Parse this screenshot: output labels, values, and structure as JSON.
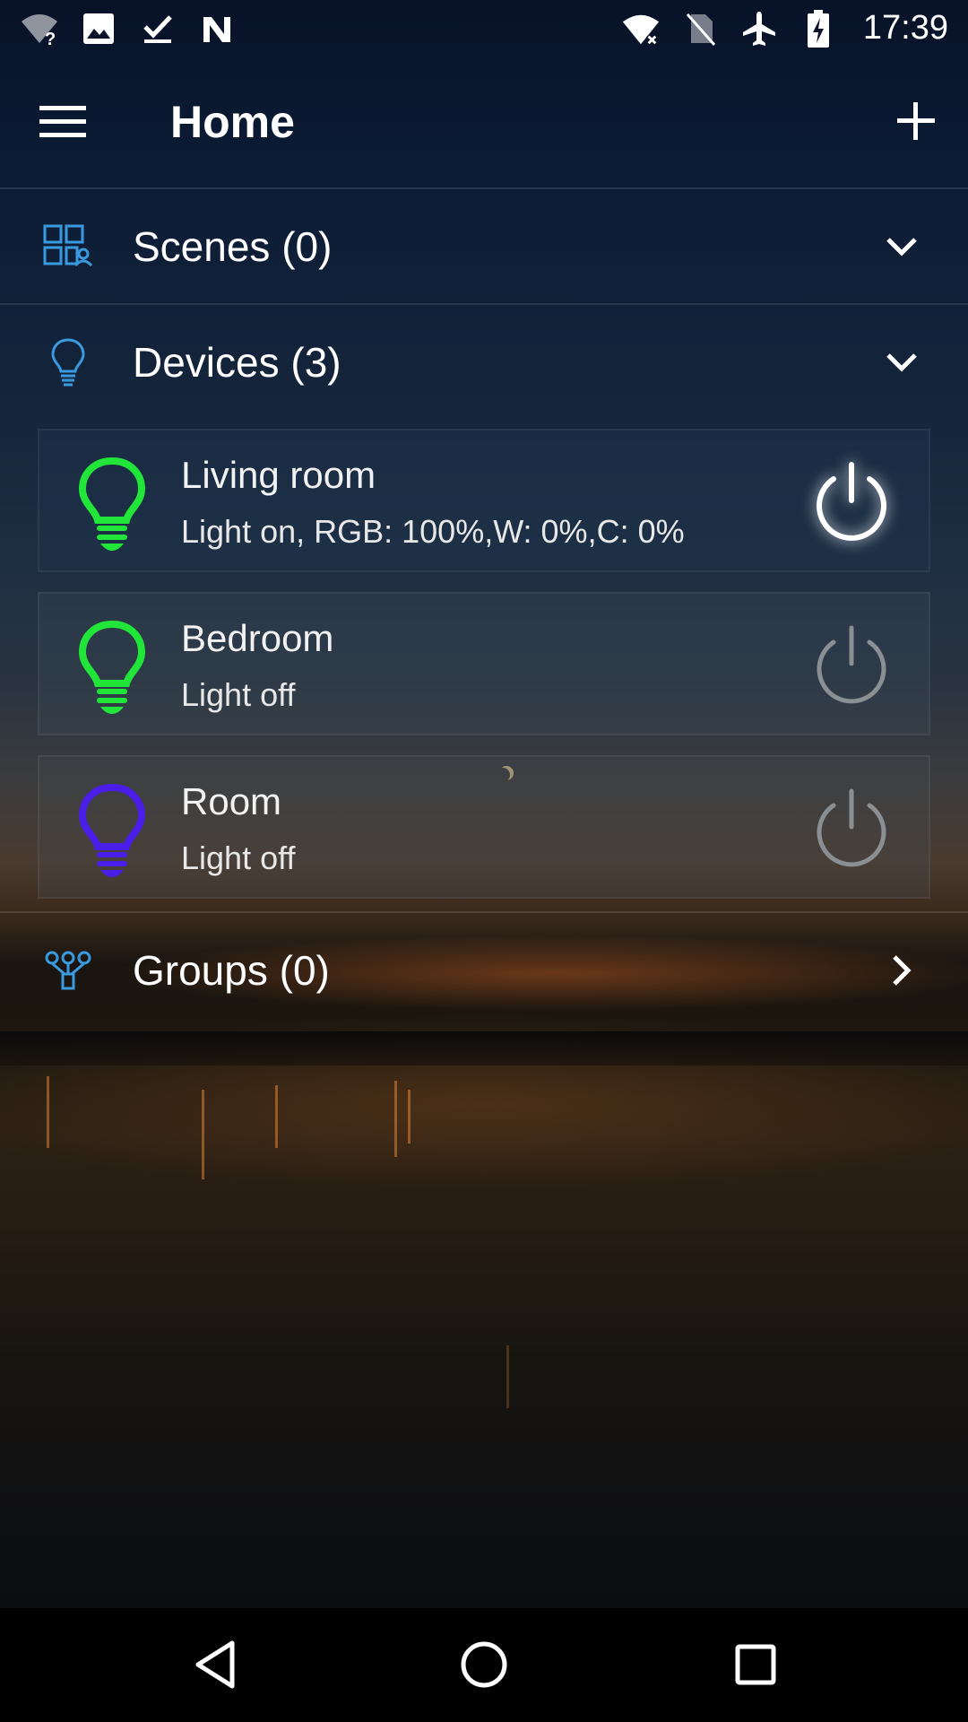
{
  "status_bar": {
    "time": "17:39",
    "left_icons": [
      "wifi-unknown-icon",
      "image-icon",
      "checkbox-done-icon",
      "nfc-n-icon"
    ],
    "right_icons": [
      "wifi-off-icon",
      "no-sim-icon",
      "airplane-icon",
      "battery-charging-icon"
    ]
  },
  "app_bar": {
    "title": "Home",
    "menu_icon": "hamburger-menu-icon",
    "add_icon": "plus-icon"
  },
  "sections": {
    "scenes": {
      "label": "Scenes (0)",
      "icon": "scenes-grid-icon",
      "chevron": "chevron-down-icon"
    },
    "devices": {
      "label": "Devices (3)",
      "icon": "lightbulb-outline-icon",
      "chevron": "chevron-down-icon"
    },
    "groups": {
      "label": "Groups (0)",
      "icon": "groups-tree-icon",
      "chevron": "chevron-right-icon"
    }
  },
  "devices": [
    {
      "name": "Living room",
      "status": "Light on, RGB: 100%,W: 0%,C: 0%",
      "bulb_color": "#22e53a",
      "power_on": true
    },
    {
      "name": "Bedroom",
      "status": "Light off",
      "bulb_color": "#22e53a",
      "power_on": false
    },
    {
      "name": "Room",
      "status": "Light off",
      "bulb_color": "#4a1ee8",
      "power_on": false
    }
  ],
  "colors": {
    "accent_blue": "#3a9ae0",
    "power_on": "#ffffff",
    "power_off": "#8a8f93"
  },
  "nav_bar": {
    "back_icon": "nav-back-icon",
    "home_icon": "nav-home-icon",
    "recents_icon": "nav-recents-icon"
  }
}
